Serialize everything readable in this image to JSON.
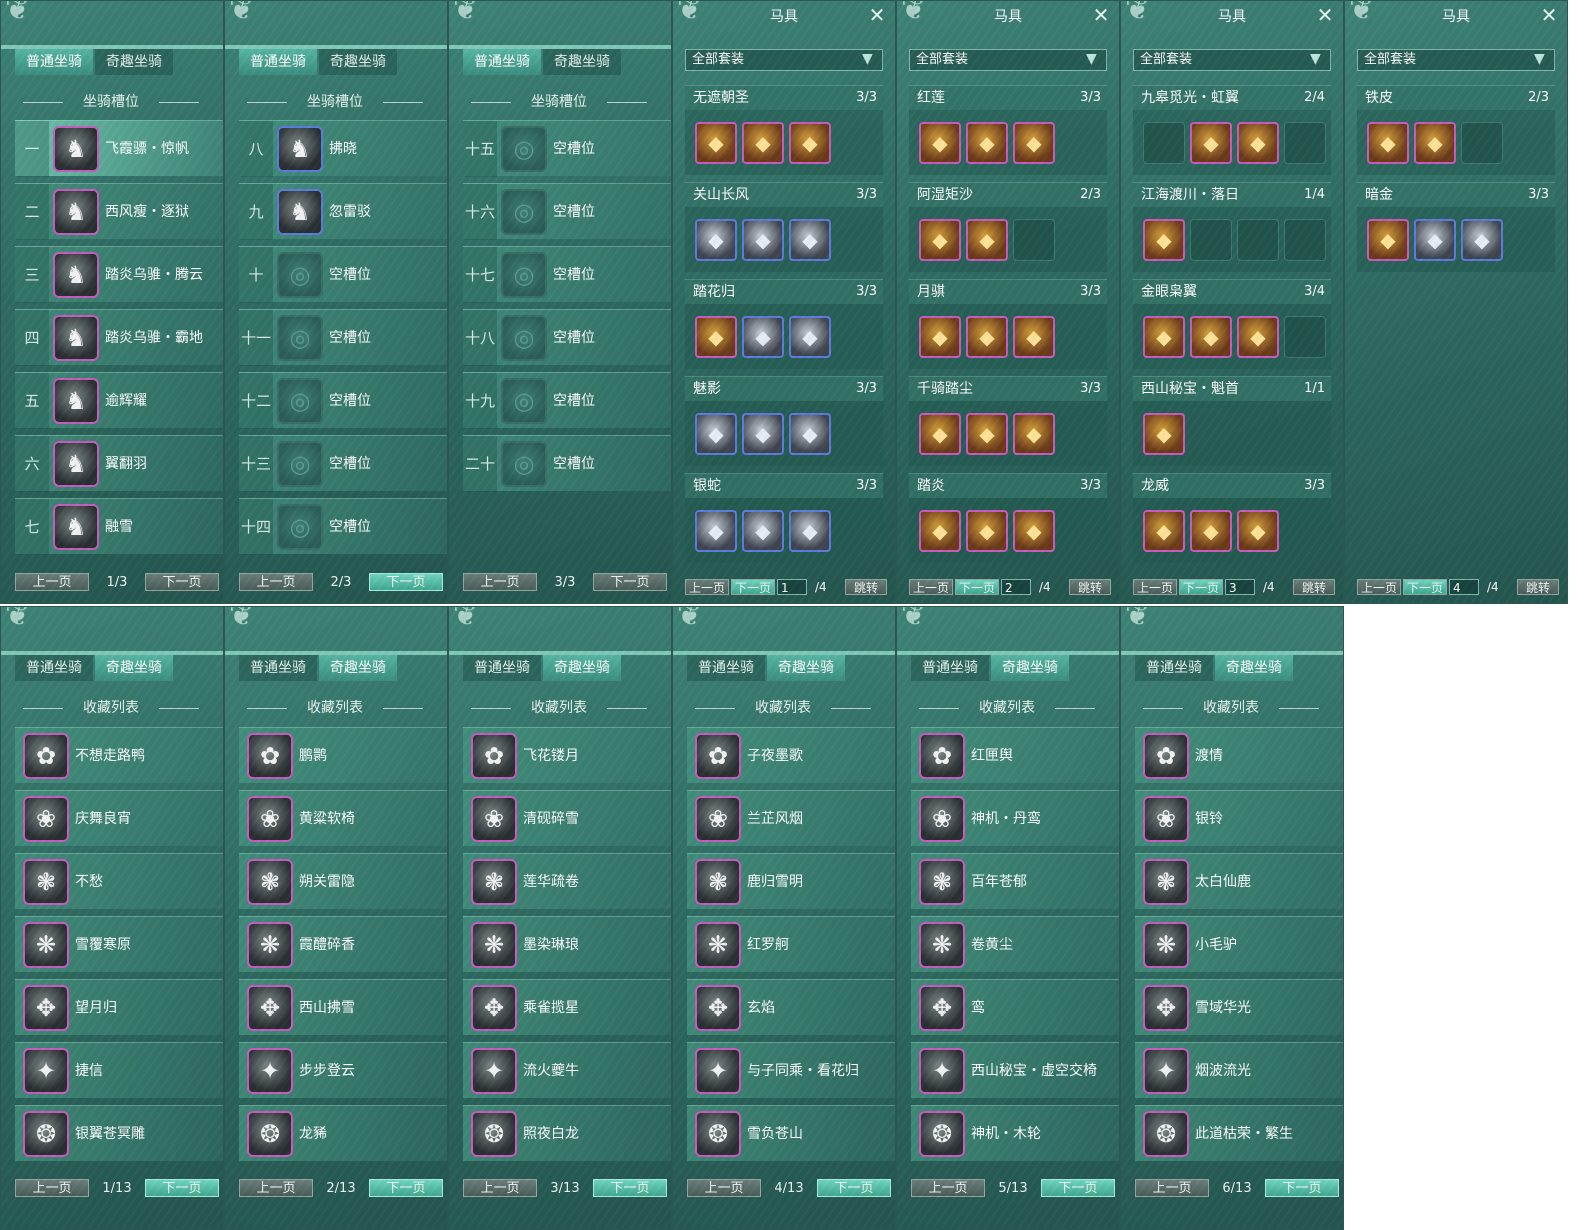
{
  "mount_tabs": {
    "normal": "普通坐骑",
    "fun": "奇趣坐骑"
  },
  "slot_panels": [
    {
      "section": "坐骑槽位",
      "page": "1/3",
      "prev": "上一页",
      "next": "下一页",
      "next_on": false,
      "rows": [
        {
          "num": "一",
          "name": "飞霞骠・惊帆",
          "empty": false,
          "sel": true
        },
        {
          "num": "二",
          "name": "西风瘦・逐狱",
          "empty": false
        },
        {
          "num": "三",
          "name": "踏炎乌骓・腾云",
          "empty": false
        },
        {
          "num": "四",
          "name": "踏炎乌骓・霸地",
          "empty": false
        },
        {
          "num": "五",
          "name": "逾辉耀",
          "empty": false
        },
        {
          "num": "六",
          "name": "翼翻羽",
          "empty": false
        },
        {
          "num": "七",
          "name": "融雪",
          "empty": false
        }
      ]
    },
    {
      "section": "坐骑槽位",
      "page": "2/3",
      "prev": "上一页",
      "next": "下一页",
      "next_on": true,
      "rows": [
        {
          "num": "八",
          "name": "拂晓",
          "empty": false
        },
        {
          "num": "九",
          "name": "忽雷驳",
          "empty": false
        },
        {
          "num": "十",
          "name": "空槽位",
          "empty": true
        },
        {
          "num": "十一",
          "name": "空槽位",
          "empty": true
        },
        {
          "num": "十二",
          "name": "空槽位",
          "empty": true
        },
        {
          "num": "十三",
          "name": "空槽位",
          "empty": true
        },
        {
          "num": "十四",
          "name": "空槽位",
          "empty": true
        }
      ]
    },
    {
      "section": "坐骑槽位",
      "page": "3/3",
      "prev": "上一页",
      "next": "下一页",
      "next_on": false,
      "rows": [
        {
          "num": "十五",
          "name": "空槽位",
          "empty": true
        },
        {
          "num": "十六",
          "name": "空槽位",
          "empty": true
        },
        {
          "num": "十七",
          "name": "空槽位",
          "empty": true
        },
        {
          "num": "十八",
          "name": "空槽位",
          "empty": true
        },
        {
          "num": "十九",
          "name": "空槽位",
          "empty": true
        },
        {
          "num": "二十",
          "name": "空槽位",
          "empty": true
        }
      ]
    }
  ],
  "gear_panels": [
    {
      "title": "马具",
      "filter": "全部套装",
      "page_input": "1",
      "total": "/4",
      "prev": "上一页",
      "next": "下一页",
      "jump": "跳转",
      "sets": [
        {
          "name": "无遮朝圣",
          "count": "3/3",
          "slots": [
            "g",
            "g",
            "g"
          ]
        },
        {
          "name": "关山长风",
          "count": "3/3",
          "slots": [
            "s",
            "s",
            "s"
          ]
        },
        {
          "name": "踏花归",
          "count": "3/3",
          "slots": [
            "g",
            "b",
            "b"
          ]
        },
        {
          "name": "魅影",
          "count": "3/3",
          "slots": [
            "s",
            "s",
            "s"
          ]
        },
        {
          "name": "银蛇",
          "count": "3/3",
          "slots": [
            "b",
            "s",
            "b"
          ]
        }
      ]
    },
    {
      "title": "马具",
      "filter": "全部套装",
      "page_input": "2",
      "total": "/4",
      "prev": "上一页",
      "next": "下一页",
      "jump": "跳转",
      "sets": [
        {
          "name": "红莲",
          "count": "3/3",
          "slots": [
            "g",
            "g",
            "g"
          ]
        },
        {
          "name": "阿湿矩沙",
          "count": "2/3",
          "slots": [
            "g",
            "g",
            "e"
          ]
        },
        {
          "name": "月骐",
          "count": "3/3",
          "slots": [
            "g",
            "g",
            "g"
          ]
        },
        {
          "name": "千骑踏尘",
          "count": "3/3",
          "slots": [
            "g",
            "g",
            "g"
          ]
        },
        {
          "name": "踏炎",
          "count": "3/3",
          "slots": [
            "g",
            "g",
            "g"
          ]
        }
      ]
    },
    {
      "title": "马具",
      "filter": "全部套装",
      "page_input": "3",
      "total": "/4",
      "prev": "上一页",
      "next": "下一页",
      "jump": "跳转",
      "sets": [
        {
          "name": "九皋觅光・虹翼",
          "count": "2/4",
          "slots": [
            "e",
            "g",
            "g",
            "e"
          ]
        },
        {
          "name": "江海渡川・落日",
          "count": "1/4",
          "slots": [
            "g",
            "e",
            "e",
            "e"
          ]
        },
        {
          "name": "金眼枭翼",
          "count": "3/4",
          "slots": [
            "g",
            "g",
            "g",
            "e"
          ]
        },
        {
          "name": "西山秘宝・魁首",
          "count": "1/1",
          "slots": [
            "g"
          ]
        },
        {
          "name": "龙威",
          "count": "3/3",
          "slots": [
            "g",
            "g",
            "g"
          ]
        }
      ]
    },
    {
      "title": "马具",
      "filter": "全部套装",
      "page_input": "4",
      "total": "/4",
      "prev": "上一页",
      "next": "下一页",
      "jump": "跳转",
      "sets": [
        {
          "name": "铁皮",
          "count": "2/3",
          "slots": [
            "g",
            "g",
            "e"
          ]
        },
        {
          "name": "暗金",
          "count": "3/3",
          "slots": [
            "g",
            "b",
            "b"
          ]
        }
      ]
    }
  ],
  "collection_panels": [
    {
      "section": "收藏列表",
      "page": "1/13",
      "prev": "上一页",
      "next": "下一页",
      "prev_on": true,
      "items": [
        "不想走路鸭",
        "庆舞良宵",
        "不愁",
        "雪覆寒原",
        "望月归",
        "捷信",
        "银翼苍冥雕"
      ]
    },
    {
      "section": "收藏列表",
      "page": "2/13",
      "prev": "上一页",
      "next": "下一页",
      "items": [
        "鹏鹮",
        "黄粱软椅",
        "朔关雷隐",
        "霞醴碎香",
        "西山拂雪",
        "步步登云",
        "龙豨"
      ]
    },
    {
      "section": "收藏列表",
      "page": "3/13",
      "prev": "上一页",
      "next": "下一页",
      "items": [
        "飞花镂月",
        "清砚碎雪",
        "莲华疏卷",
        "墨染琳琅",
        "乘雀揽星",
        "流火夔牛",
        "照夜白龙"
      ]
    },
    {
      "section": "收藏列表",
      "page": "4/13",
      "prev": "上一页",
      "next": "下一页",
      "items": [
        "子夜墨歌",
        "兰芷风烟",
        "鹿归雪明",
        "红罗舸",
        "玄焰",
        "与子同乘・看花归",
        "雪负苍山"
      ]
    },
    {
      "section": "收藏列表",
      "page": "5/13",
      "prev": "上一页",
      "next": "下一页",
      "items": [
        "红匣舆",
        "神机・丹鸾",
        "百年苍郁",
        "卷黄尘",
        "鸾",
        "西山秘宝・虚空交椅",
        "神机・木轮"
      ]
    },
    {
      "section": "收藏列表",
      "page": "6/13",
      "prev": "上一页",
      "next": "下一页",
      "items": [
        "渡情",
        "银铃",
        "太白仙鹿",
        "小毛驴",
        "雪域华光",
        "烟波流光",
        "此道枯荣・繁生"
      ]
    }
  ],
  "colors": {
    "panel": "#2f6b62",
    "accent": "#56b7a3",
    "purple_frame": "#c85cbf",
    "blue_frame": "#5b7ce0"
  }
}
